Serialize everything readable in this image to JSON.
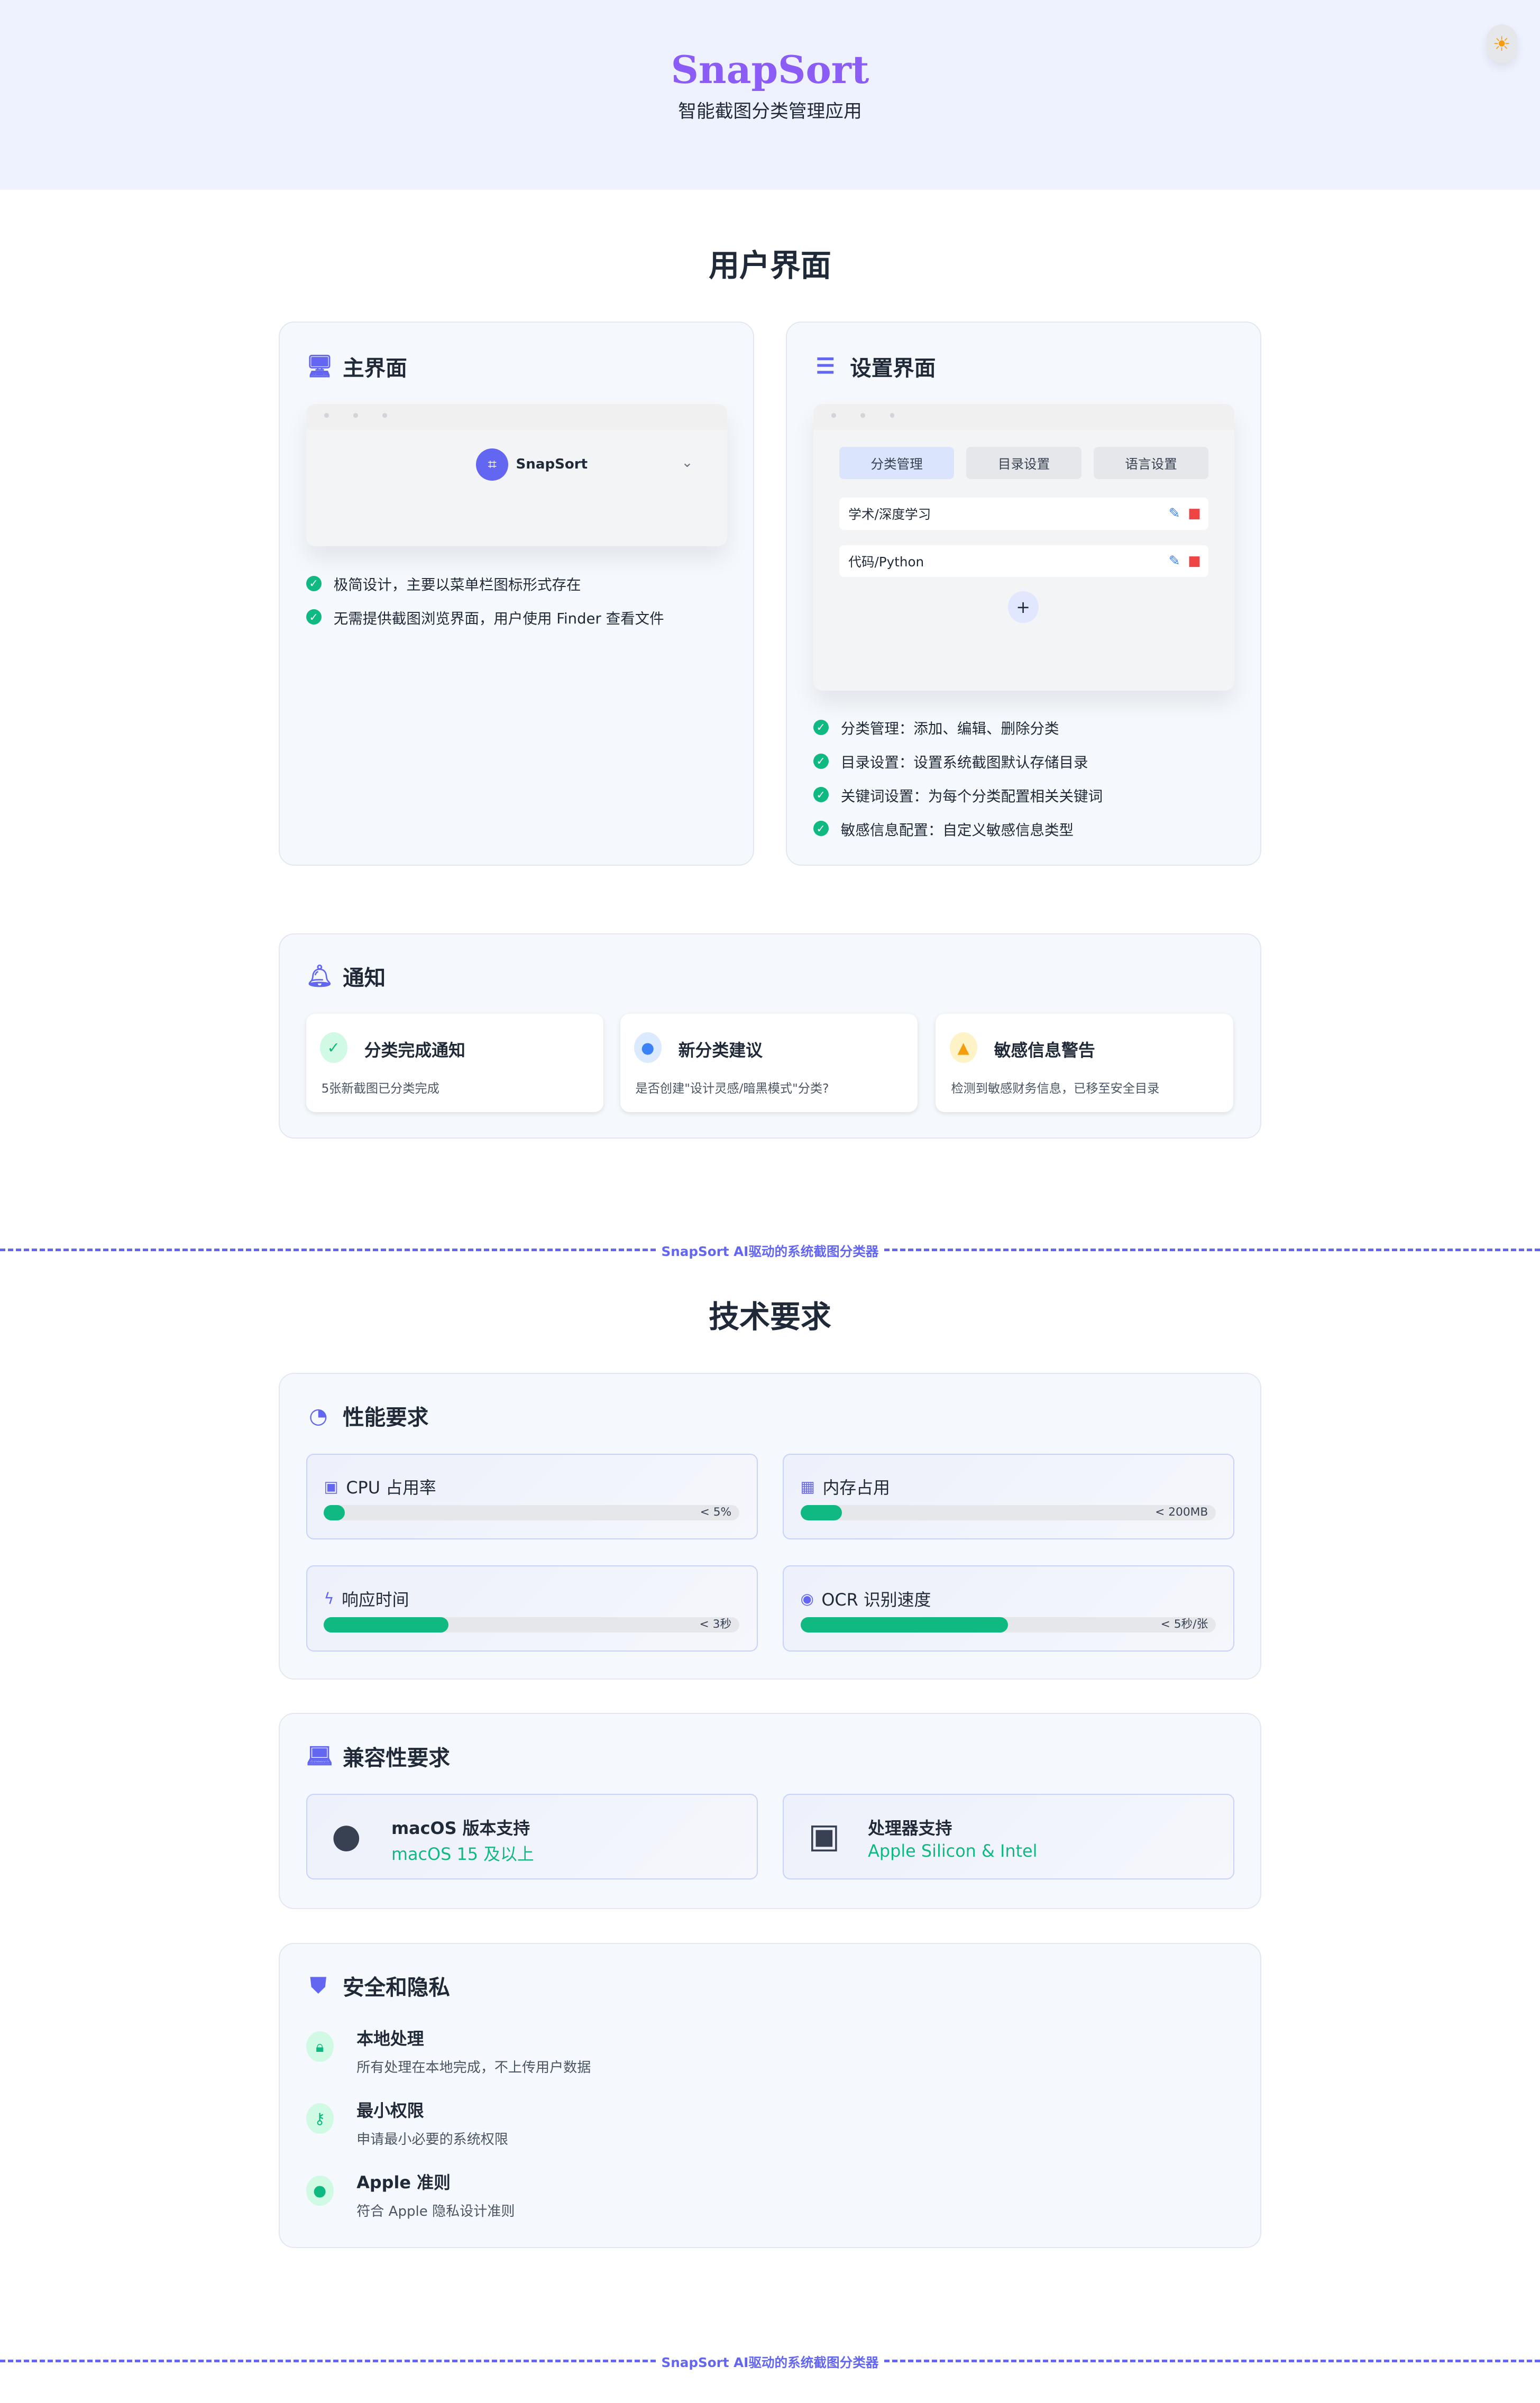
{
  "header": {
    "title": "SnapSort",
    "subtitle": "智能截图分类管理应用",
    "theme_icon": "sun-icon"
  },
  "ui_section": {
    "heading": "用户界面",
    "main_card": {
      "title": "主界面",
      "app_name": "SnapSort",
      "bullets": [
        "极简设计，主要以菜单栏图标形式存在",
        "无需提供截图浏览界面，用户使用 Finder 查看文件"
      ]
    },
    "settings_card": {
      "title": "设置界面",
      "tabs": [
        "分类管理",
        "目录设置",
        "语言设置"
      ],
      "categories": [
        "学术/深度学习",
        "代码/Python"
      ],
      "add_label": "+",
      "bullets": [
        "分类管理：添加、编辑、删除分类",
        "目录设置：设置系统截图默认存储目录",
        "关键词设置：为每个分类配置相关关键词",
        "敏感信息配置：自定义敏感信息类型"
      ]
    },
    "notifications": {
      "title": "通知",
      "items": [
        {
          "title": "分类完成通知",
          "desc": "5张新截图已分类完成",
          "color": "#10b981"
        },
        {
          "title": "新分类建议",
          "desc": "是否创建\"设计灵感/暗黑模式\"分类?",
          "color": "#3b82f6"
        },
        {
          "title": "敏感信息警告",
          "desc": "检测到敏感财务信息，已移至安全目录",
          "color": "#f59e0b"
        }
      ]
    }
  },
  "divider_text": "SnapSort AI驱动的系统截图分类器",
  "tech_section": {
    "heading": "技术要求",
    "performance": {
      "title": "性能要求",
      "items": [
        {
          "label": "CPU 占用率",
          "limit": "< 5%",
          "progress": 5
        },
        {
          "label": "内存占用",
          "limit": "< 200MB",
          "progress": 10
        },
        {
          "label": "响应时间",
          "limit": "< 3秒",
          "progress": 30
        },
        {
          "label": "OCR 识别速度",
          "limit": "< 5秒/张",
          "progress": 50
        }
      ]
    },
    "compatibility": {
      "title": "兼容性要求",
      "items": [
        {
          "label": "macOS 版本支持",
          "value": "macOS 15 及以上"
        },
        {
          "label": "处理器支持",
          "value": "Apple Silicon & Intel"
        }
      ]
    },
    "security": {
      "title": "安全和隐私",
      "items": [
        {
          "title": "本地处理",
          "desc": "所有处理在本地完成，不上传用户数据"
        },
        {
          "title": "最小权限",
          "desc": "申请最小必要的系统权限"
        },
        {
          "title": "Apple 准则",
          "desc": "符合 Apple 隐私设计准则"
        }
      ]
    }
  },
  "colors": {
    "accent": "#6366f1",
    "brand": "#8b5cf6",
    "success": "#10b981"
  }
}
